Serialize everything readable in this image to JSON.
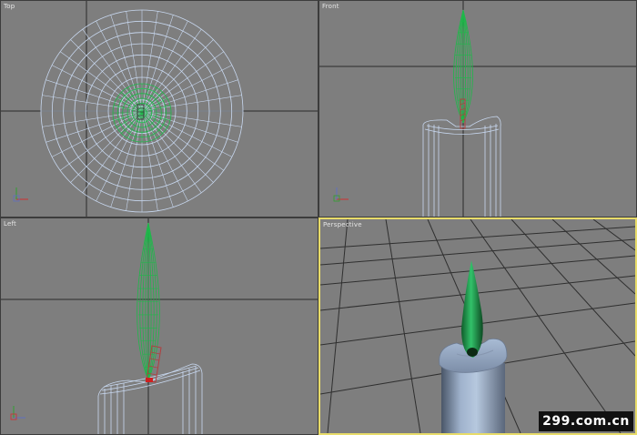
{
  "viewports": {
    "top": {
      "label": "Top"
    },
    "front": {
      "label": "Front"
    },
    "left": {
      "label": "Left"
    },
    "perspective": {
      "label": "Perspective",
      "active": true
    }
  },
  "watermark": "299.com.cn",
  "colors": {
    "viewport_bg": "#7e7e7e",
    "active_border": "#e8dc6a",
    "wireframe_candle": "#c8d8f0",
    "wireframe_flame": "#1fb84a",
    "wick": "#c04040",
    "grid_line": "#2a2a2a"
  }
}
